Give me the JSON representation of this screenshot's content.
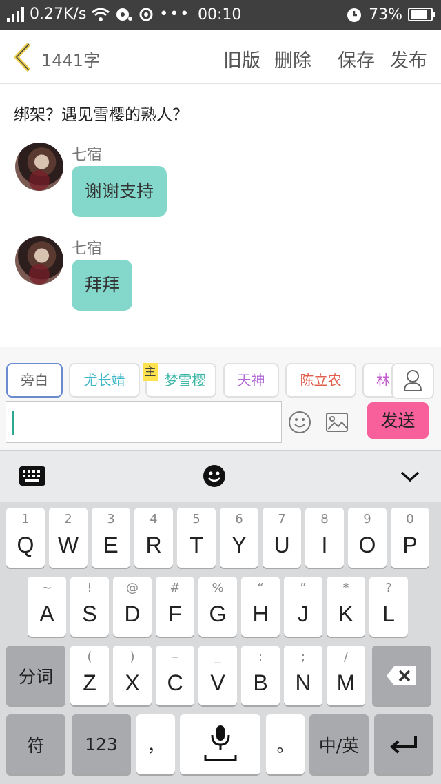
{
  "status_bar": {
    "speed": "0.27K/s",
    "time": "00:10",
    "battery": "73%"
  },
  "header": {
    "word_count": "1441字",
    "old_version": "旧版",
    "delete": "删除",
    "save": "保存",
    "publish": "发布"
  },
  "story_title": "绑架？遇见雪樱的熟人？",
  "messages": [
    {
      "sender": "七宿",
      "text": "谢谢支持"
    },
    {
      "sender": "七宿",
      "text": "拜拜"
    }
  ],
  "characters": [
    {
      "name": "旁白",
      "color": "#666666"
    },
    {
      "name": "尤长靖",
      "color": "#3fb7c8"
    },
    {
      "name": "梦雪樱",
      "color": "#3fb7a6"
    },
    {
      "name": "天神",
      "color": "#b26bd6"
    },
    {
      "name": "陈立农",
      "color": "#e0604e"
    },
    {
      "name": "林",
      "color": "#c45fd0"
    }
  ],
  "main_badge": "主",
  "send_label": "发送",
  "keyboard": {
    "row1": [
      {
        "sub": "1",
        "main": "Q"
      },
      {
        "sub": "2",
        "main": "W"
      },
      {
        "sub": "3",
        "main": "E"
      },
      {
        "sub": "4",
        "main": "R"
      },
      {
        "sub": "5",
        "main": "T"
      },
      {
        "sub": "6",
        "main": "Y"
      },
      {
        "sub": "7",
        "main": "U"
      },
      {
        "sub": "8",
        "main": "I"
      },
      {
        "sub": "9",
        "main": "O"
      },
      {
        "sub": "0",
        "main": "P"
      }
    ],
    "row2": [
      {
        "sub": "~",
        "main": "A"
      },
      {
        "sub": "!",
        "main": "S"
      },
      {
        "sub": "@",
        "main": "D"
      },
      {
        "sub": "#",
        "main": "F"
      },
      {
        "sub": "%",
        "main": "G"
      },
      {
        "sub": "“",
        "main": "H"
      },
      {
        "sub": "”",
        "main": "J"
      },
      {
        "sub": "*",
        "main": "K"
      },
      {
        "sub": "?",
        "main": "L"
      }
    ],
    "row3": [
      {
        "sub": "(",
        "main": "Z"
      },
      {
        "sub": ")",
        "main": "X"
      },
      {
        "sub": "–",
        "main": "C"
      },
      {
        "sub": "_",
        "main": "V"
      },
      {
        "sub": ":",
        "main": "B"
      },
      {
        "sub": ";",
        "main": "N"
      },
      {
        "sub": "/",
        "main": "M"
      }
    ],
    "segment": "分词",
    "symbols": "符",
    "numbers": "123",
    "comma": "，",
    "period": "。",
    "lang": "中/英"
  }
}
